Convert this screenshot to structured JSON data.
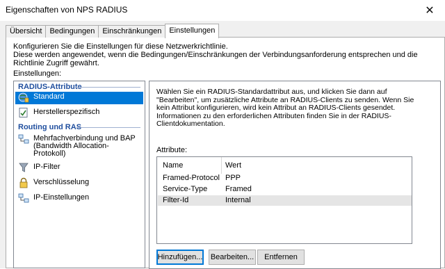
{
  "window": {
    "title": "Eigenschaften von NPS RADIUS",
    "close_glyph": "✕"
  },
  "tabs": [
    {
      "label": "Übersicht",
      "active": false
    },
    {
      "label": "Bedingungen",
      "active": false
    },
    {
      "label": "Einschränkungen",
      "active": false
    },
    {
      "label": "Einstellungen",
      "active": true
    }
  ],
  "intro": {
    "line1": "Konfigurieren Sie die Einstellungen für diese Netzwerkrichtlinie.",
    "line2": "Diese werden angewendet, wenn die Bedingungen/Einschränkungen der Verbindungsanforderung entsprechen und die Richtlinie Zugriff gewährt."
  },
  "settings_label": "Einstellungen:",
  "nav": {
    "groups": [
      {
        "header": "RADIUS-Attribute",
        "items": [
          {
            "label": "Standard",
            "icon": "globe-icon",
            "selected": true
          },
          {
            "label": "Herstellerspezifisch",
            "icon": "checklist-icon",
            "selected": false
          }
        ]
      },
      {
        "header": "Routing und RAS",
        "items": [
          {
            "label": "Mehrfachverbindung und BAP (Bandwidth Allocation-Protokoll)",
            "icon": "network-icon",
            "selected": false
          },
          {
            "label": "IP-Filter",
            "icon": "filter-icon",
            "selected": false
          },
          {
            "label": "Verschlüsselung",
            "icon": "lock-icon",
            "selected": false
          },
          {
            "label": "IP-Einstellungen",
            "icon": "network-icon",
            "selected": false
          }
        ]
      }
    ]
  },
  "detail": {
    "description": "Wählen Sie ein RADIUS-Standardattribut aus, und klicken Sie dann auf \"Bearbeiten\", um zusätzliche Attribute an RADIUS-Clients zu senden. Wenn Sie kein Attribut konfigurieren, wird kein Attribut an RADIUS-Clients gesendet. Informationen zu den erforderlichen Attributen finden Sie in der RADIUS-Clientdokumentation.",
    "attributes_label": "Attribute:",
    "columns": [
      "Name",
      "Wert"
    ],
    "rows": [
      {
        "name": "Framed-Protocol",
        "value": "PPP",
        "selected": false
      },
      {
        "name": "Service-Type",
        "value": "Framed",
        "selected": false
      },
      {
        "name": "Filter-Id",
        "value": "Internal",
        "selected": true
      }
    ],
    "buttons": {
      "add": "Hinzufügen...",
      "edit": "Bearbeiten...",
      "remove": "Entfernen"
    }
  },
  "colors": {
    "selection": "#0078d7",
    "group_header": "#1f4e9e"
  }
}
